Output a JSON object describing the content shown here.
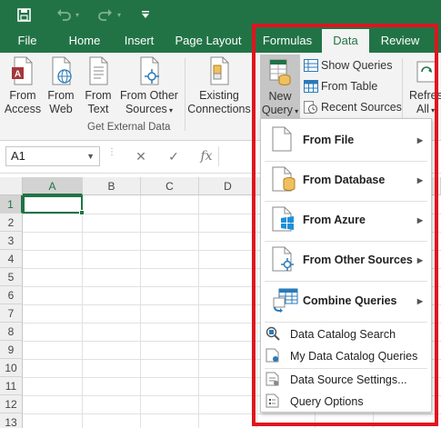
{
  "title_bar": {
    "save_icon": "save-icon",
    "undo_icon": "undo-icon",
    "redo_icon": "redo-icon",
    "customize_icon": "customize-qat-icon"
  },
  "tabs": [
    {
      "label": "File"
    },
    {
      "label": "Home"
    },
    {
      "label": "Insert"
    },
    {
      "label": "Page Layout"
    },
    {
      "label": "Formulas"
    },
    {
      "label": "Data"
    },
    {
      "label": "Review"
    }
  ],
  "ribbon": {
    "from_access": {
      "line1": "From",
      "line2": "Access"
    },
    "from_web": {
      "line1": "From",
      "line2": "Web"
    },
    "from_text": {
      "line1": "From",
      "line2": "Text"
    },
    "from_other_sources": {
      "line1": "From Other",
      "line2": "Sources"
    },
    "existing_connections": {
      "line1": "Existing",
      "line2": "Connections"
    },
    "get_external_data_label": "Get External Data",
    "new_query": {
      "line1": "New",
      "line2": "Query"
    },
    "show_queries": "Show Queries",
    "from_table": "From Table",
    "recent_sources": "Recent Sources",
    "refresh_all": {
      "line1": "Refresh",
      "line2": "All"
    }
  },
  "formula_bar": {
    "name_box": "A1",
    "cancel_symbol": "✕",
    "enter_symbol": "✓",
    "fx_symbol": "fx",
    "value": ""
  },
  "grid": {
    "columns": [
      "A",
      "B",
      "C",
      "D"
    ],
    "rows": [
      "1",
      "2",
      "3",
      "4",
      "5",
      "6",
      "7",
      "8",
      "9",
      "10",
      "11",
      "12",
      "13"
    ],
    "active_cell": "A1"
  },
  "new_query_menu": {
    "items": [
      {
        "label": "From File",
        "icon": "file-icon",
        "has_submenu": true
      },
      {
        "label": "From Database",
        "icon": "database-icon",
        "has_submenu": true
      },
      {
        "label": "From Azure",
        "icon": "azure-icon",
        "has_submenu": true
      },
      {
        "label": "From Other Sources",
        "icon": "other-sources-icon",
        "has_submenu": true
      },
      {
        "label": "Combine Queries",
        "icon": "combine-queries-icon",
        "has_submenu": true
      },
      {
        "label": "Data Catalog Search",
        "icon": "catalog-search-icon",
        "has_submenu": false
      },
      {
        "label": "My Data Catalog Queries",
        "icon": "catalog-queries-icon",
        "has_submenu": false
      },
      {
        "label": "Data Source Settings...",
        "icon": "data-source-settings-icon",
        "has_submenu": false
      },
      {
        "label": "Query Options",
        "icon": "query-options-icon",
        "has_submenu": false
      }
    ]
  },
  "colors": {
    "excel_green": "#217346",
    "highlight_red": "#e0141e"
  }
}
